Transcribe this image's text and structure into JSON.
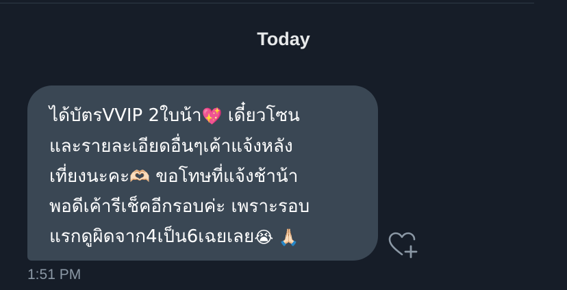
{
  "conversation": {
    "date_header": "Today"
  },
  "message": {
    "lines": [
      {
        "text": "ได้บัตรVVIP 2ใบน้า",
        "emoji": "💖",
        "after": " เดี๋ยวโซน"
      },
      {
        "text": "และรายละเอียดอื่นๆเค้าแจ้งหลัง",
        "emoji": "",
        "after": ""
      },
      {
        "text": "เที่ยงนะคะ",
        "emoji": "🫶🏻",
        "after": " ขอโทษที่แจ้งช้าน้า"
      },
      {
        "text": "พอดีเค้ารีเช็คอีกรอบค่ะ เพราะรอบ",
        "emoji": "",
        "after": ""
      },
      {
        "text": "แรกดูผิดจาก4เป็น6เฉยเลย",
        "emoji": "😭 🙏🏻",
        "after": ""
      }
    ],
    "timestamp": "1:51 PM",
    "react_icon": "heart-plus-icon"
  },
  "colors": {
    "background": "#161d28",
    "bubble": "#3a4754",
    "text": "#ffffff",
    "muted": "#8b98a5"
  }
}
